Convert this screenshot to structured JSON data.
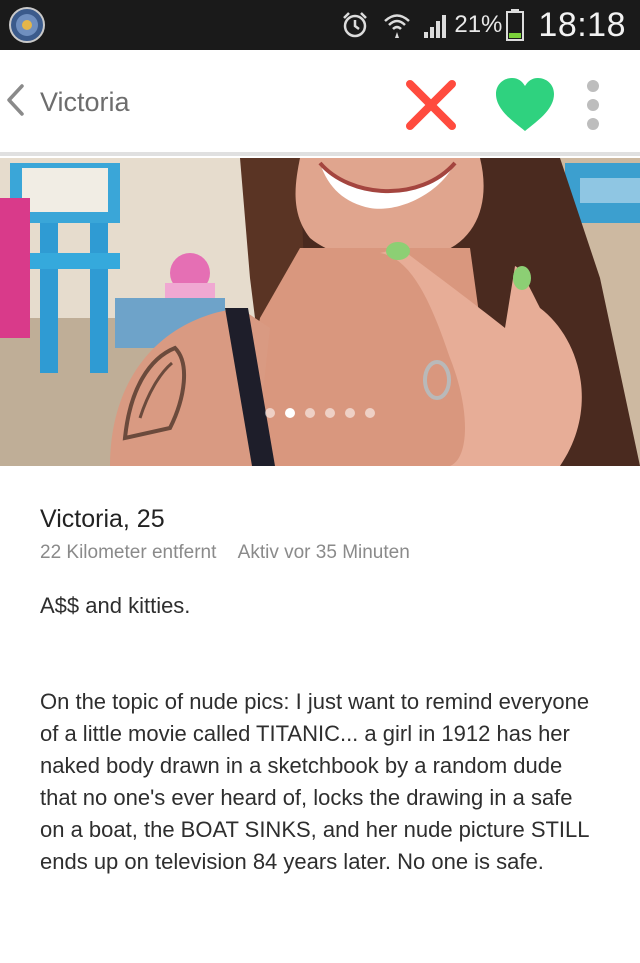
{
  "status_bar": {
    "battery_percent": "21%",
    "time": "18:18",
    "icons": [
      "app-badge-icon",
      "alarm-icon",
      "wifi-icon",
      "signal-icon",
      "battery-icon"
    ]
  },
  "action_bar": {
    "back_title": "Victoria",
    "icons": [
      "chevron-left-icon",
      "nope-x-icon",
      "heart-icon",
      "overflow-menu-icon"
    ]
  },
  "photo": {
    "page_count": 6,
    "active_index": 1
  },
  "profile": {
    "name_age": "Victoria, 25",
    "distance": "22 Kilometer entfernt",
    "last_active": "Aktiv vor 35 Minuten",
    "bio_lines": [
      "A$$ and kitties.",
      "On the topic of nude pics: I just want to remind everyone of a little movie called TITANIC... a girl in 1912 has her naked body drawn in a sketchbook by a random dude that no one's ever heard of, locks the drawing in a safe on a boat, the BOAT SINKS, and her nude picture STILL ends up on television 84 years later. No one is safe."
    ]
  },
  "colors": {
    "status_bar_bg": "#1a1a1a",
    "nope_red": "#ff4b3e",
    "like_green": "#2fd27f",
    "title_gray": "#6d6d6d",
    "meta_gray": "#8a8a8a",
    "battery_green": "#7bd13a"
  }
}
